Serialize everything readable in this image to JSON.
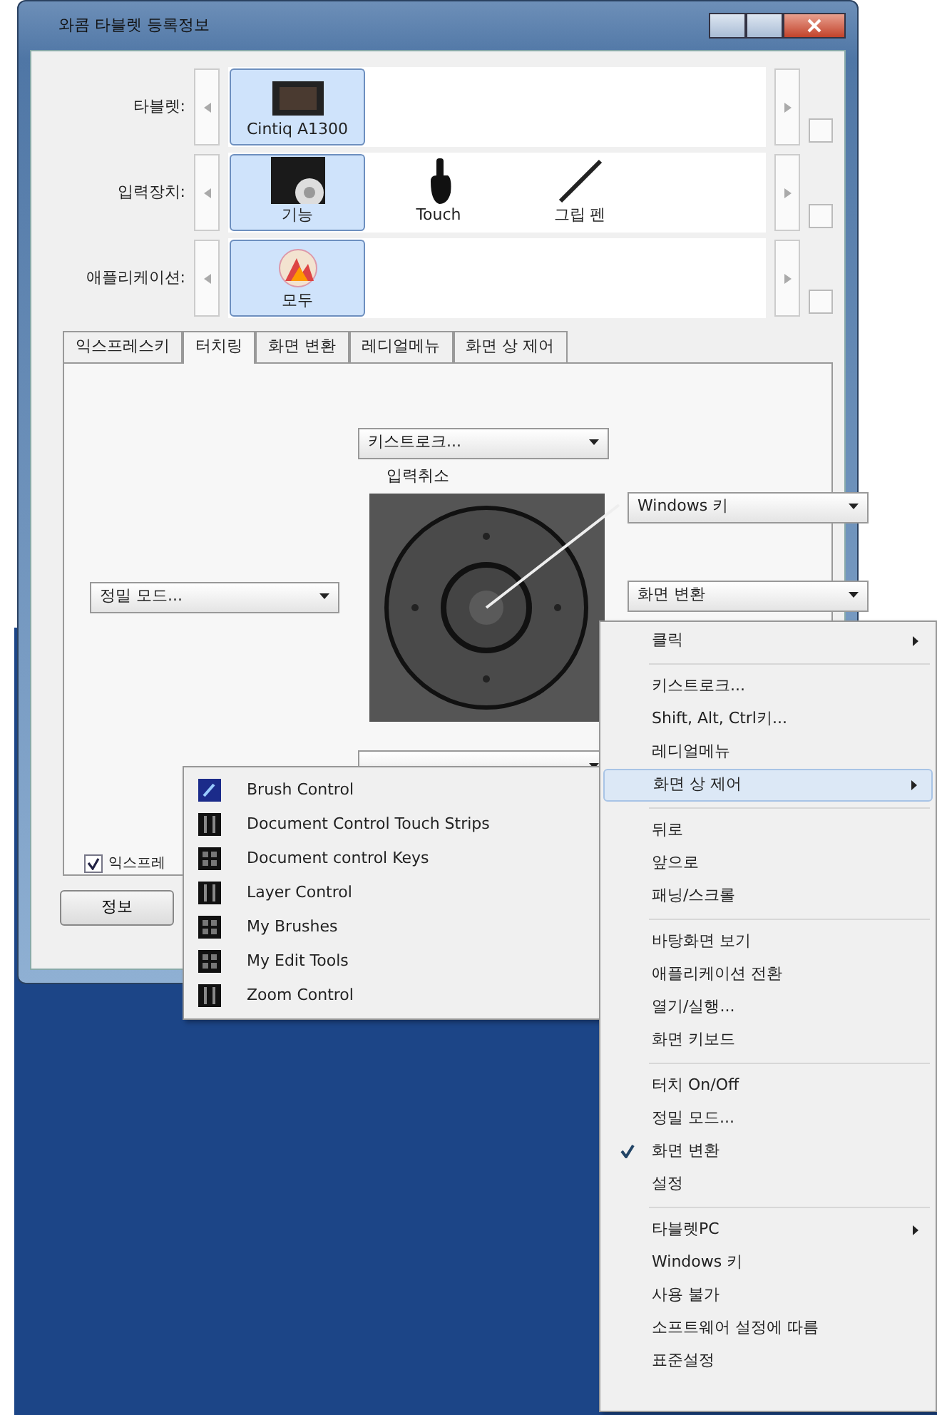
{
  "window": {
    "title": "와콤 타블렛 등록정보"
  },
  "device_rows": [
    {
      "label": "타블렛:",
      "items": [
        {
          "label": "Cintiq A1300",
          "kind": "tablet",
          "selected": true
        }
      ]
    },
    {
      "label": "입력장치:",
      "items": [
        {
          "label": "기능",
          "kind": "function",
          "selected": true
        },
        {
          "label": "Touch",
          "kind": "touch",
          "selected": false
        },
        {
          "label": "그립 펜",
          "kind": "pen",
          "selected": false
        }
      ]
    },
    {
      "label": "애플리케이션:",
      "items": [
        {
          "label": "모두",
          "kind": "apps",
          "selected": true
        }
      ]
    }
  ],
  "tabs": [
    {
      "label": "익스프레스키",
      "selected": false
    },
    {
      "label": "터치링",
      "selected": true
    },
    {
      "label": "화면 변환",
      "selected": false
    },
    {
      "label": "레디얼메뉴",
      "selected": false
    },
    {
      "label": "화면 상 제어",
      "selected": false
    }
  ],
  "touch_ring": {
    "top_dropdown": "키스트로크...",
    "center_label": "입력취소",
    "right_top_dropdown": "Windows 키",
    "left_dropdown": "정밀 모드...",
    "right_dropdown": "화면 변환"
  },
  "checkbox": {
    "label": "익스프레",
    "checked": true
  },
  "buttons": [
    "정보"
  ],
  "context_menu": {
    "groups": [
      [
        {
          "label": "클릭",
          "submenu": true,
          "checked": false,
          "selected": false
        }
      ],
      [
        {
          "label": "키스트로크...",
          "submenu": false,
          "checked": false,
          "selected": false
        },
        {
          "label": "Shift, Alt, Ctrl키...",
          "submenu": false,
          "checked": false,
          "selected": false
        },
        {
          "label": "레디얼메뉴",
          "submenu": false,
          "checked": false,
          "selected": false
        },
        {
          "label": "화면 상 제어",
          "submenu": true,
          "checked": false,
          "selected": true
        }
      ],
      [
        {
          "label": "뒤로",
          "submenu": false,
          "checked": false,
          "selected": false
        },
        {
          "label": "앞으로",
          "submenu": false,
          "checked": false,
          "selected": false
        },
        {
          "label": "패닝/스크롤",
          "submenu": false,
          "checked": false,
          "selected": false
        }
      ],
      [
        {
          "label": "바탕화면 보기",
          "submenu": false,
          "checked": false,
          "selected": false
        },
        {
          "label": "애플리케이션 전환",
          "submenu": false,
          "checked": false,
          "selected": false
        },
        {
          "label": "열기/실행...",
          "submenu": false,
          "checked": false,
          "selected": false
        },
        {
          "label": "화면 키보드",
          "submenu": false,
          "checked": false,
          "selected": false
        }
      ],
      [
        {
          "label": "터치 On/Off",
          "submenu": false,
          "checked": false,
          "selected": false
        },
        {
          "label": "정밀 모드...",
          "submenu": false,
          "checked": false,
          "selected": false
        },
        {
          "label": "화면 변환",
          "submenu": false,
          "checked": true,
          "selected": false
        },
        {
          "label": "설정",
          "submenu": false,
          "checked": false,
          "selected": false
        }
      ],
      [
        {
          "label": "타블렛PC",
          "submenu": true,
          "checked": false,
          "selected": false
        },
        {
          "label": "Windows 키",
          "submenu": false,
          "checked": false,
          "selected": false
        },
        {
          "label": "사용 불가",
          "submenu": false,
          "checked": false,
          "selected": false
        },
        {
          "label": "소프트웨어 설정에 따름",
          "submenu": false,
          "checked": false,
          "selected": false
        },
        {
          "label": "표준설정",
          "submenu": false,
          "checked": false,
          "selected": false
        }
      ]
    ]
  },
  "submenu": [
    {
      "label": "Brush Control",
      "kind": "brush"
    },
    {
      "label": "Document Control Touch Strips",
      "kind": "strip"
    },
    {
      "label": "Document control Keys",
      "kind": "keys"
    },
    {
      "label": "Layer Control",
      "kind": "strip"
    },
    {
      "label": "My Brushes",
      "kind": "keys"
    },
    {
      "label": "My Edit Tools",
      "kind": "keys"
    },
    {
      "label": "Zoom Control",
      "kind": "strip"
    }
  ]
}
